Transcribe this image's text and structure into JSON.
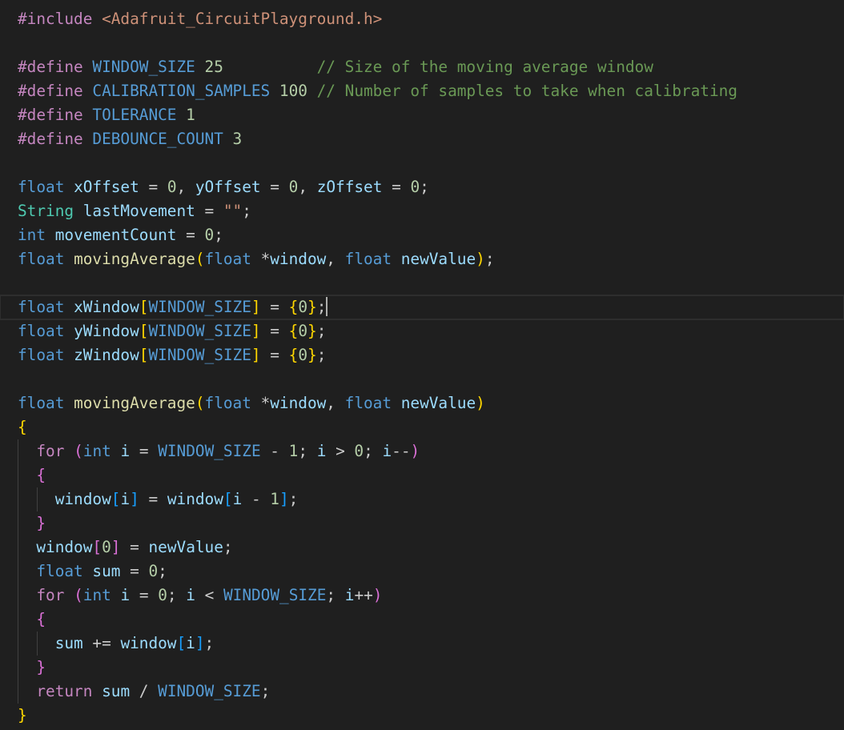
{
  "colors": {
    "background": "#1f1f1f",
    "preprocessor": "#c586c0",
    "include_path": "#ce9178",
    "macro": "#569cd6",
    "number": "#b5cea8",
    "comment": "#6a9955",
    "keyword_type": "#569cd6",
    "class_type": "#4ec9b0",
    "variable": "#9cdcfe",
    "function": "#dcdcaa",
    "control": "#c586c0",
    "text": "#cccccc",
    "bracket_gold": "#ffd700",
    "bracket_purple": "#da70d6",
    "bracket_blue": "#179fff"
  },
  "editor": {
    "cursor_line": 12,
    "lines": [
      [
        [
          "#include ",
          "preprocessor"
        ],
        [
          "<Adafruit_CircuitPlayground.h>",
          "include_path"
        ]
      ],
      [],
      [
        [
          "#define ",
          "preprocessor"
        ],
        [
          "WINDOW_SIZE",
          "macro"
        ],
        [
          " ",
          "text"
        ],
        [
          "25",
          "number"
        ],
        [
          "          ",
          "text"
        ],
        [
          "// Size of the moving average window",
          "comment"
        ]
      ],
      [
        [
          "#define ",
          "preprocessor"
        ],
        [
          "CALIBRATION_SAMPLES",
          "macro"
        ],
        [
          " ",
          "text"
        ],
        [
          "100",
          "number"
        ],
        [
          " ",
          "text"
        ],
        [
          "// Number of samples to take when calibrating",
          "comment"
        ]
      ],
      [
        [
          "#define ",
          "preprocessor"
        ],
        [
          "TOLERANCE",
          "macro"
        ],
        [
          " ",
          "text"
        ],
        [
          "1",
          "number"
        ]
      ],
      [
        [
          "#define ",
          "preprocessor"
        ],
        [
          "DEBOUNCE_COUNT",
          "macro"
        ],
        [
          " ",
          "text"
        ],
        [
          "3",
          "number"
        ]
      ],
      [],
      [
        [
          "float",
          "keyword_type"
        ],
        [
          " ",
          "text"
        ],
        [
          "xOffset",
          "variable"
        ],
        [
          " = ",
          "text"
        ],
        [
          "0",
          "number"
        ],
        [
          ", ",
          "text"
        ],
        [
          "yOffset",
          "variable"
        ],
        [
          " = ",
          "text"
        ],
        [
          "0",
          "number"
        ],
        [
          ", ",
          "text"
        ],
        [
          "zOffset",
          "variable"
        ],
        [
          " = ",
          "text"
        ],
        [
          "0",
          "number"
        ],
        [
          ";",
          "text"
        ]
      ],
      [
        [
          "String",
          "class_type"
        ],
        [
          " ",
          "text"
        ],
        [
          "lastMovement",
          "variable"
        ],
        [
          " = ",
          "text"
        ],
        [
          "\"\"",
          "include_path"
        ],
        [
          ";",
          "text"
        ]
      ],
      [
        [
          "int",
          "keyword_type"
        ],
        [
          " ",
          "text"
        ],
        [
          "movementCount",
          "variable"
        ],
        [
          " = ",
          "text"
        ],
        [
          "0",
          "number"
        ],
        [
          ";",
          "text"
        ]
      ],
      [
        [
          "float",
          "keyword_type"
        ],
        [
          " ",
          "text"
        ],
        [
          "movingAverage",
          "function"
        ],
        [
          "(",
          "bracket_gold"
        ],
        [
          "float",
          "keyword_type"
        ],
        [
          " *",
          "text"
        ],
        [
          "window",
          "variable"
        ],
        [
          ", ",
          "text"
        ],
        [
          "float",
          "keyword_type"
        ],
        [
          " ",
          "text"
        ],
        [
          "newValue",
          "variable"
        ],
        [
          ")",
          "bracket_gold"
        ],
        [
          ";",
          "text"
        ]
      ],
      [],
      [
        [
          "float",
          "keyword_type"
        ],
        [
          " ",
          "text"
        ],
        [
          "xWindow",
          "variable"
        ],
        [
          "[",
          "bracket_gold"
        ],
        [
          "WINDOW_SIZE",
          "macro"
        ],
        [
          "]",
          "bracket_gold"
        ],
        [
          " = ",
          "text"
        ],
        [
          "{",
          "bracket_gold"
        ],
        [
          "0",
          "number"
        ],
        [
          "}",
          "bracket_gold"
        ],
        [
          ";",
          "text"
        ]
      ],
      [
        [
          "float",
          "keyword_type"
        ],
        [
          " ",
          "text"
        ],
        [
          "yWindow",
          "variable"
        ],
        [
          "[",
          "bracket_gold"
        ],
        [
          "WINDOW_SIZE",
          "macro"
        ],
        [
          "]",
          "bracket_gold"
        ],
        [
          " = ",
          "text"
        ],
        [
          "{",
          "bracket_gold"
        ],
        [
          "0",
          "number"
        ],
        [
          "}",
          "bracket_gold"
        ],
        [
          ";",
          "text"
        ]
      ],
      [
        [
          "float",
          "keyword_type"
        ],
        [
          " ",
          "text"
        ],
        [
          "zWindow",
          "variable"
        ],
        [
          "[",
          "bracket_gold"
        ],
        [
          "WINDOW_SIZE",
          "macro"
        ],
        [
          "]",
          "bracket_gold"
        ],
        [
          " = ",
          "text"
        ],
        [
          "{",
          "bracket_gold"
        ],
        [
          "0",
          "number"
        ],
        [
          "}",
          "bracket_gold"
        ],
        [
          ";",
          "text"
        ]
      ],
      [],
      [
        [
          "float",
          "keyword_type"
        ],
        [
          " ",
          "text"
        ],
        [
          "movingAverage",
          "function"
        ],
        [
          "(",
          "bracket_gold"
        ],
        [
          "float",
          "keyword_type"
        ],
        [
          " *",
          "text"
        ],
        [
          "window",
          "variable"
        ],
        [
          ", ",
          "text"
        ],
        [
          "float",
          "keyword_type"
        ],
        [
          " ",
          "text"
        ],
        [
          "newValue",
          "variable"
        ],
        [
          ")",
          "bracket_gold"
        ]
      ],
      [
        [
          "{",
          "bracket_gold"
        ]
      ],
      [
        [
          "  ",
          "text"
        ],
        [
          "for",
          "control"
        ],
        [
          " ",
          "text"
        ],
        [
          "(",
          "bracket_purple"
        ],
        [
          "int",
          "keyword_type"
        ],
        [
          " ",
          "text"
        ],
        [
          "i",
          "variable"
        ],
        [
          " = ",
          "text"
        ],
        [
          "WINDOW_SIZE",
          "macro"
        ],
        [
          " - ",
          "text"
        ],
        [
          "1",
          "number"
        ],
        [
          "; ",
          "text"
        ],
        [
          "i",
          "variable"
        ],
        [
          " > ",
          "text"
        ],
        [
          "0",
          "number"
        ],
        [
          "; ",
          "text"
        ],
        [
          "i",
          "variable"
        ],
        [
          "--",
          "text"
        ],
        [
          ")",
          "bracket_purple"
        ]
      ],
      [
        [
          "  ",
          "text"
        ],
        [
          "{",
          "bracket_purple"
        ]
      ],
      [
        [
          "    ",
          "text"
        ],
        [
          "window",
          "variable"
        ],
        [
          "[",
          "bracket_blue"
        ],
        [
          "i",
          "variable"
        ],
        [
          "]",
          "bracket_blue"
        ],
        [
          " = ",
          "text"
        ],
        [
          "window",
          "variable"
        ],
        [
          "[",
          "bracket_blue"
        ],
        [
          "i",
          "variable"
        ],
        [
          " - ",
          "text"
        ],
        [
          "1",
          "number"
        ],
        [
          "]",
          "bracket_blue"
        ],
        [
          ";",
          "text"
        ]
      ],
      [
        [
          "  ",
          "text"
        ],
        [
          "}",
          "bracket_purple"
        ]
      ],
      [
        [
          "  ",
          "text"
        ],
        [
          "window",
          "variable"
        ],
        [
          "[",
          "bracket_purple"
        ],
        [
          "0",
          "number"
        ],
        [
          "]",
          "bracket_purple"
        ],
        [
          " = ",
          "text"
        ],
        [
          "newValue",
          "variable"
        ],
        [
          ";",
          "text"
        ]
      ],
      [
        [
          "  ",
          "text"
        ],
        [
          "float",
          "keyword_type"
        ],
        [
          " ",
          "text"
        ],
        [
          "sum",
          "variable"
        ],
        [
          " = ",
          "text"
        ],
        [
          "0",
          "number"
        ],
        [
          ";",
          "text"
        ]
      ],
      [
        [
          "  ",
          "text"
        ],
        [
          "for",
          "control"
        ],
        [
          " ",
          "text"
        ],
        [
          "(",
          "bracket_purple"
        ],
        [
          "int",
          "keyword_type"
        ],
        [
          " ",
          "text"
        ],
        [
          "i",
          "variable"
        ],
        [
          " = ",
          "text"
        ],
        [
          "0",
          "number"
        ],
        [
          "; ",
          "text"
        ],
        [
          "i",
          "variable"
        ],
        [
          " < ",
          "text"
        ],
        [
          "WINDOW_SIZE",
          "macro"
        ],
        [
          "; ",
          "text"
        ],
        [
          "i",
          "variable"
        ],
        [
          "++",
          "text"
        ],
        [
          ")",
          "bracket_purple"
        ]
      ],
      [
        [
          "  ",
          "text"
        ],
        [
          "{",
          "bracket_purple"
        ]
      ],
      [
        [
          "    ",
          "text"
        ],
        [
          "sum",
          "variable"
        ],
        [
          " += ",
          "text"
        ],
        [
          "window",
          "variable"
        ],
        [
          "[",
          "bracket_blue"
        ],
        [
          "i",
          "variable"
        ],
        [
          "]",
          "bracket_blue"
        ],
        [
          ";",
          "text"
        ]
      ],
      [
        [
          "  ",
          "text"
        ],
        [
          "}",
          "bracket_purple"
        ]
      ],
      [
        [
          "  ",
          "text"
        ],
        [
          "return",
          "control"
        ],
        [
          " ",
          "text"
        ],
        [
          "sum",
          "variable"
        ],
        [
          " / ",
          "text"
        ],
        [
          "WINDOW_SIZE",
          "macro"
        ],
        [
          ";",
          "text"
        ]
      ],
      [
        [
          "}",
          "bracket_gold"
        ]
      ]
    ]
  }
}
